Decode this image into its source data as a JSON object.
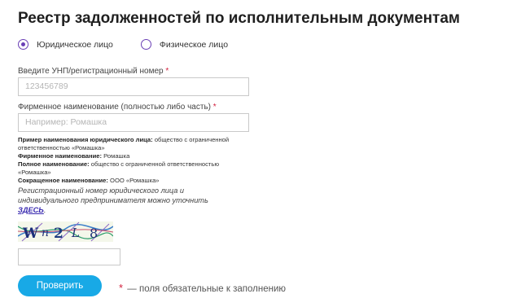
{
  "title": "Реестр задолженностей по исполнительным документам",
  "radio": {
    "legal_label": "Юридическое лицо",
    "individual_label": "Физическое лицо",
    "selected": "legal"
  },
  "unp": {
    "label": "Введите УНП/регистрационный номер",
    "required_mark": "*",
    "placeholder": "123456789"
  },
  "company_name": {
    "label": "Фирменное наименование (полностью либо часть)",
    "required_mark": "*",
    "placeholder": "Например: Ромашка"
  },
  "hints": [
    {
      "term": "Пример наименования юридического лица:",
      "text": "общество с ограниченной ответственностью «Ромашка»"
    },
    {
      "term": "Фирменное наименование:",
      "text": "Ромашка"
    },
    {
      "term": "Полное наименование:",
      "text": "общество с ограниченной ответственностью «Ромашка»"
    },
    {
      "term": "Сокращенное наименование:",
      "text": "ООО «Ромашка»"
    }
  ],
  "note": {
    "text": "Регистрационный номер юридического лица и индивидуального предпринимателя можно уточнить",
    "link": "ЗДЕСЬ",
    "end": "."
  },
  "captcha": {
    "alt": "Wn2L8"
  },
  "submit_label": "Проверить",
  "footnote": {
    "mark": "*",
    "text": "— поля обязательные к заполнению"
  },
  "colors": {
    "accent_button": "#18a9e6",
    "radio": "#6a3fb5",
    "required": "#d21f3c"
  }
}
